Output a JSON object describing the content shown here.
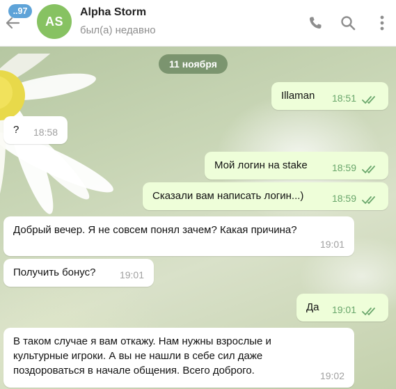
{
  "header": {
    "unread_count": "..97",
    "avatar_initials": "AS",
    "avatar_color": "#87c262",
    "chat_title": "Alpha Storm",
    "chat_status": "был(а) недавно",
    "icons": [
      "back-arrow-icon",
      "phone-icon",
      "search-icon",
      "more-vertical-icon"
    ]
  },
  "chat": {
    "date_separator": "11 ноября",
    "messages": [
      {
        "direction": "out",
        "text": "Illaman",
        "time": "18:51",
        "status": "read"
      },
      {
        "direction": "in",
        "text": "?",
        "time": "18:58"
      },
      {
        "direction": "out",
        "text": "Мой логин на stake",
        "time": "18:59",
        "status": "read"
      },
      {
        "direction": "out",
        "text": "Сказали вам написать логин...)",
        "time": "18:59",
        "status": "read"
      },
      {
        "direction": "in",
        "text": "Добрый вечер. Я не совсем понял зачем? Какая причина?",
        "time": "19:01"
      },
      {
        "direction": "in",
        "text": "Получить бонус?",
        "time": "19:01"
      },
      {
        "direction": "out",
        "text": "Да",
        "time": "19:01",
        "status": "read"
      },
      {
        "direction": "in",
        "text": "В таком случае я вам откажу. Нам нужны взрослые и культурные игроки. А вы не нашли в себе сил даже поздороваться в начале общения. Всего доброго.",
        "time": "19:02"
      }
    ]
  },
  "colors": {
    "outgoing_bubble": "#eefed9",
    "incoming_bubble": "#ffffff",
    "read_ticks": "#69a66b",
    "date_pill": "#68845d"
  }
}
